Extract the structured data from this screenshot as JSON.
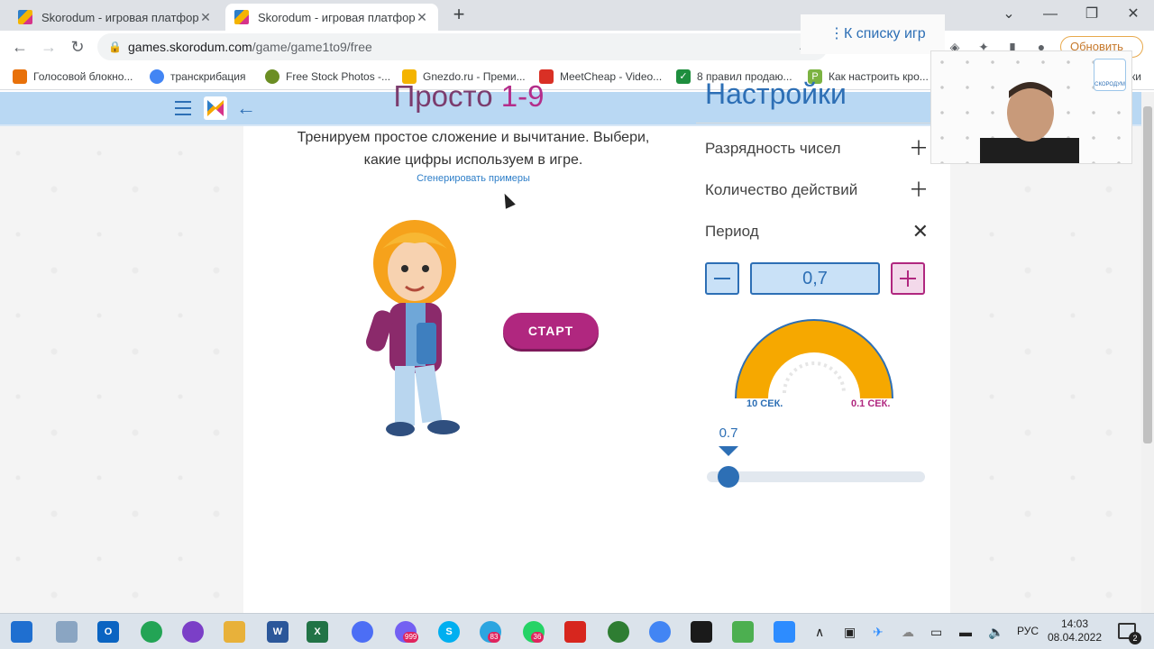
{
  "browser": {
    "tabs": [
      {
        "title": "Skorodum - игровая платформа",
        "active": false
      },
      {
        "title": "Skorodum - игровая платформа",
        "active": true
      }
    ],
    "url_host": "games.skorodum.com",
    "url_path": "/game/game1to9/free",
    "update_label": "Обновить",
    "bookmarks": [
      {
        "label": "Голосовой блокно...",
        "color": "#e8710a"
      },
      {
        "label": "транскрибация",
        "color": "#4285f4"
      },
      {
        "label": "Free Stock Photos -...",
        "color": "#6b8e23"
      },
      {
        "label": "Gnezdo.ru - Преми...",
        "color": "#f4b400"
      },
      {
        "label": "MeetCheap - Video...",
        "color": "#d93025"
      },
      {
        "label": "8 правил продаю...",
        "color": "#1e8e3e"
      },
      {
        "label": "Как настроить кро...",
        "color": "#7cb342"
      },
      {
        "label": "ски",
        "color": "#9e9e9e"
      }
    ]
  },
  "site": {
    "list_link": "К списку игр",
    "game": {
      "title_word": "Просто",
      "title_num": "1-9",
      "description": "Тренируем простое сложение и вычитание. Выбери, какие цифры используем в игре.",
      "generate_link": "Сгенерировать примеры",
      "start_label": "СТАРТ"
    },
    "settings": {
      "title": "Настройки",
      "rows": [
        {
          "label": "Разрядность чисел",
          "icon": "plus-icon"
        },
        {
          "label": "Количество действий",
          "icon": "plus-icon"
        },
        {
          "label": "Период",
          "icon": "close-icon"
        }
      ],
      "period_value": "0,7",
      "gauge_left": "10 СЕК.",
      "gauge_right": "0.1 СЕК.",
      "slider_value": "0.7",
      "slider_fraction": 0.06
    }
  },
  "webcam": {
    "badge": "СКОРОДУМ"
  },
  "taskbar": {
    "icons": [
      {
        "name": "windows-start-icon",
        "label": "",
        "color": "#1f6fd0"
      },
      {
        "name": "file-explorer-alt-icon",
        "label": "",
        "color": "#8aa5c2"
      },
      {
        "name": "outlook-icon",
        "label": "O",
        "color": "#0a64c2"
      },
      {
        "name": "green-app-icon",
        "label": "",
        "color": "#23a455"
      },
      {
        "name": "podcast-icon",
        "label": "",
        "color": "#7b3fc7"
      },
      {
        "name": "folder-icon",
        "label": "",
        "color": "#e8b13a"
      },
      {
        "name": "word-icon",
        "label": "W",
        "color": "#2b579a"
      },
      {
        "name": "excel-icon",
        "label": "X",
        "color": "#217346"
      },
      {
        "name": "messenger-icon",
        "label": "",
        "color": "#4c6ef5"
      },
      {
        "name": "viber-icon",
        "label": "",
        "color": "#7360f2"
      },
      {
        "name": "skype-icon",
        "label": "S",
        "color": "#00aff0"
      },
      {
        "name": "telegram-icon",
        "label": "",
        "color": "#2ca5e0"
      },
      {
        "name": "whatsapp-icon",
        "label": "",
        "color": "#25d366"
      },
      {
        "name": "acrobat-icon",
        "label": "",
        "color": "#d7261e"
      },
      {
        "name": "bug-app-icon",
        "label": "",
        "color": "#2e7d32"
      },
      {
        "name": "chrome-icon",
        "label": "",
        "color": "#4285f4"
      },
      {
        "name": "terminal-icon",
        "label": "",
        "color": "#1a1a1a"
      },
      {
        "name": "camtasia-icon",
        "label": "",
        "color": "#4caf50"
      },
      {
        "name": "zoom-icon",
        "label": "",
        "color": "#2d8cff"
      }
    ],
    "badges": {
      "viber": "999",
      "telegram": "83",
      "whatsapp": "36"
    },
    "lang": "РУС",
    "time": "14:03",
    "date": "08.04.2022",
    "notifications": "2"
  }
}
